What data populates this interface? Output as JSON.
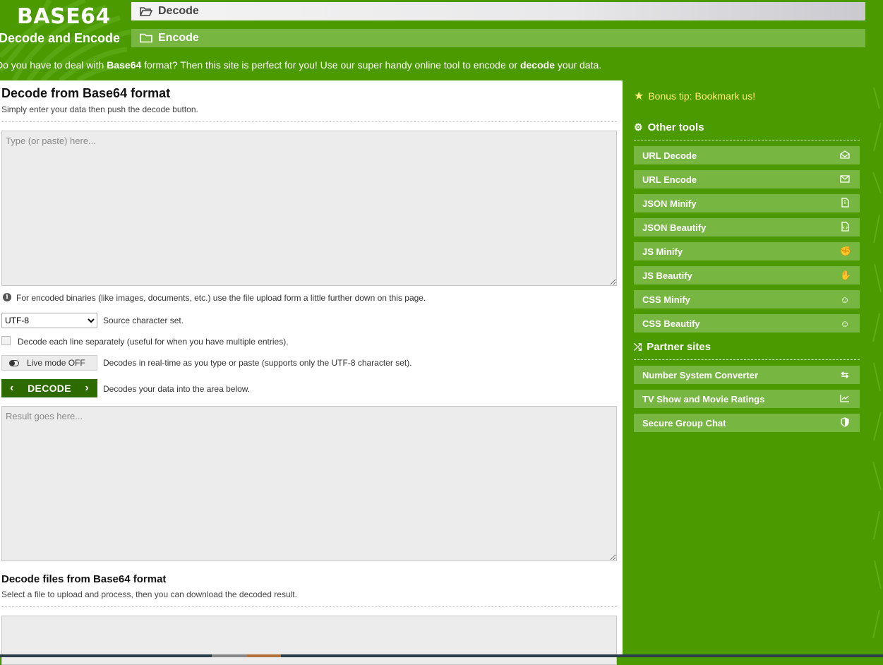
{
  "header": {
    "logo_title": "BASE64",
    "logo_subtitle": "Decode and Encode",
    "tabs": [
      {
        "label": "Decode",
        "icon": "folder-open-icon"
      },
      {
        "label": "Encode",
        "icon": "folder-icon"
      }
    ],
    "intro": {
      "part1": "Do you have to deal with ",
      "bold1": "Base64",
      "part2": " format? Then this site is perfect for you! Use our super handy online tool to encode or ",
      "bold2": "decode",
      "part3": " your data."
    }
  },
  "main": {
    "title": "Decode from Base64 format",
    "subtitle": "Simply enter your data then push the decode button.",
    "input_placeholder": "Type (or paste) here...",
    "binary_note": "For encoded binaries (like images, documents, etc.) use the file upload form a little further down on this page.",
    "charset": {
      "selected": "UTF-8",
      "label": "Source character set."
    },
    "line_option": "Decode each line separately (useful for when you have multiple entries).",
    "live_mode": {
      "label": "Live mode OFF",
      "desc": "Decodes in real-time as you type or paste (supports only the UTF-8 character set)."
    },
    "decode_button": {
      "label": "DECODE",
      "desc": "Decodes your data into the area below."
    },
    "result_placeholder": "Result goes here...",
    "files_title": "Decode files from Base64 format",
    "files_subtitle": "Select a file to upload and process, then you can download the decoded result."
  },
  "sidebar": {
    "bonus_tip": "Bonus tip: Bookmark us!",
    "other_tools_title": "Other tools",
    "other_tools": [
      {
        "label": "URL Decode",
        "icon": "envelope-open-icon"
      },
      {
        "label": "URL Encode",
        "icon": "envelope-icon"
      },
      {
        "label": "JSON Minify",
        "icon": "file-zip-icon"
      },
      {
        "label": "JSON Beautify",
        "icon": "file-code-icon"
      },
      {
        "label": "JS Minify",
        "icon": "hand-rock-icon"
      },
      {
        "label": "JS Beautify",
        "icon": "hand-paper-icon"
      },
      {
        "label": "CSS Minify",
        "icon": "smile-icon"
      },
      {
        "label": "CSS Beautify",
        "icon": "smile-icon"
      }
    ],
    "partner_title": "Partner sites",
    "partners": [
      {
        "label": "Number System Converter",
        "icon": "exchange-icon"
      },
      {
        "label": "TV Show and Movie Ratings",
        "icon": "chart-line-icon"
      },
      {
        "label": "Secure Group Chat",
        "icon": "shield-icon"
      }
    ]
  },
  "colors": {
    "brand_green": "#4a9a00",
    "light_green": "#77b741",
    "dark_green_button": "#2d6a00",
    "bonus_yellow": "#ffef7a"
  }
}
